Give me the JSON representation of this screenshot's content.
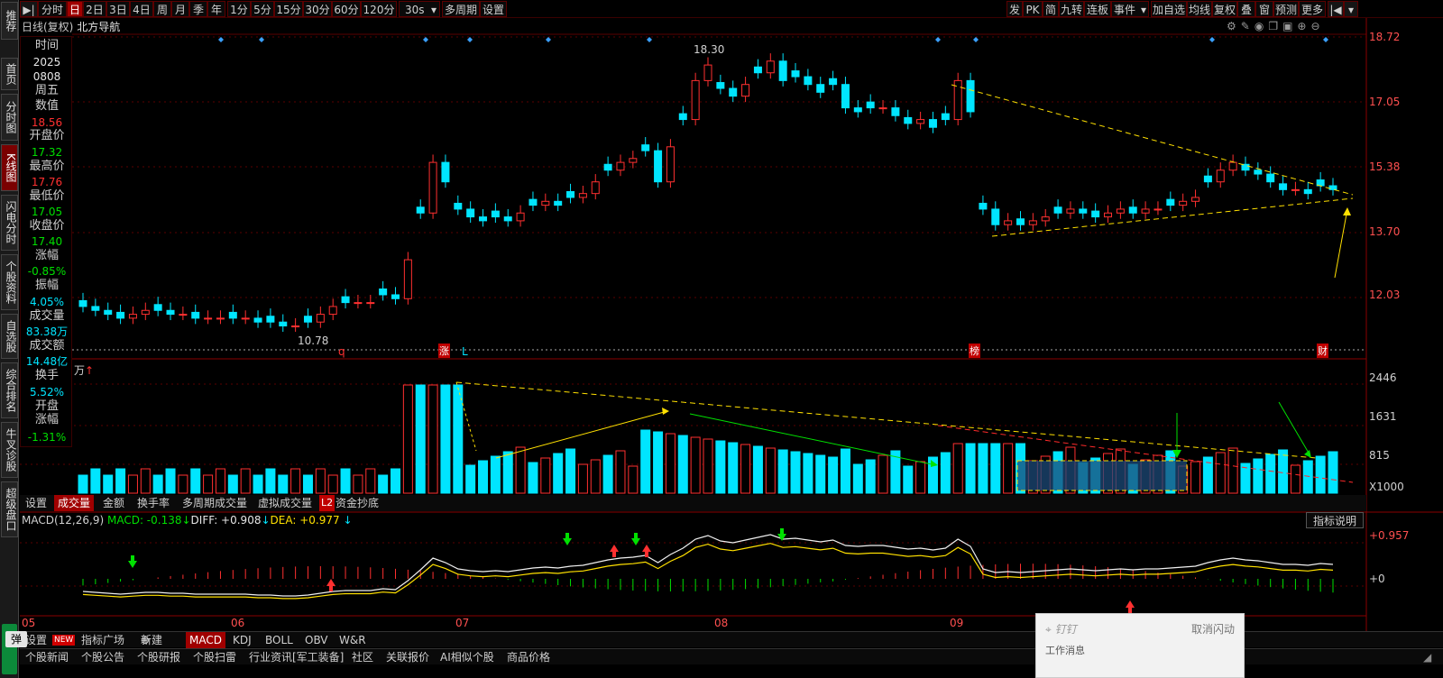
{
  "sidebar": {
    "items": [
      {
        "label": "推荐"
      },
      {
        "label": "首页"
      },
      {
        "label": "分时图"
      },
      {
        "label": "K线图"
      },
      {
        "label": "闪电分时"
      },
      {
        "label": "个股资料"
      },
      {
        "label": "自选股"
      },
      {
        "label": "综合排名"
      },
      {
        "label": "牛叉诊股"
      },
      {
        "label": "超级盘口"
      }
    ]
  },
  "toolbar": {
    "left": [
      "分时",
      "日",
      "2日",
      "3日",
      "4日",
      "周",
      "月",
      "季",
      "年",
      "1分",
      "5分",
      "15分",
      "30分",
      "60分",
      "120分",
      "30s",
      "多周期",
      "设置"
    ],
    "right": [
      "发",
      "PK",
      "简",
      "九转",
      "连板",
      "事件",
      "加自选",
      "均线",
      "复权",
      "叠",
      "窗",
      "预测",
      "更多"
    ],
    "active": "日"
  },
  "chart": {
    "title": "日线(复权)",
    "stock": "北方导航",
    "yaxis": [
      "18.72",
      "17.05",
      "15.38",
      "13.70",
      "12.03"
    ],
    "high_label": "18.30",
    "low_label": "10.78",
    "markers": [
      {
        "text": "q"
      },
      {
        "text": "涨"
      },
      {
        "text": "L"
      },
      {
        "text": "榜"
      },
      {
        "text": "财"
      }
    ]
  },
  "info": {
    "rows": [
      {
        "label": "时间",
        "value": "2025",
        "value2": "0808",
        "value3": "周五"
      },
      {
        "label": "数值",
        "value": "18.56"
      },
      {
        "label": "开盘价",
        "value": "17.32"
      },
      {
        "label": "最高价",
        "value": "17.76"
      },
      {
        "label": "最低价",
        "value": "17.05"
      },
      {
        "label": "收盘价",
        "value": "17.40"
      },
      {
        "label": "涨幅",
        "value": "-0.85%"
      },
      {
        "label": "振幅",
        "value": "4.05%"
      },
      {
        "label": "成交量",
        "value": "83.38万"
      },
      {
        "label": "成交额",
        "value": "14.48亿"
      },
      {
        "label": "换手",
        "value": "5.52%"
      },
      {
        "label": "开盘涨幅",
        "value": "-1.31%"
      }
    ]
  },
  "volume": {
    "unit": "万",
    "yaxis": [
      "2446",
      "1631",
      "815",
      "X1000"
    ]
  },
  "tabs2": {
    "items": [
      "设置",
      "成交量",
      "金额",
      "换手率",
      "多周期成交量",
      "虚拟成交量",
      "资金抄底"
    ],
    "active": "成交量",
    "l2": "L2"
  },
  "macd": {
    "label": "MACD(12,26,9)",
    "macd": "MACD: -0.138",
    "diff": "DIFF: +0.908",
    "dea": "DEA: +0.977",
    "yaxis": [
      "+0.957",
      "+0"
    ],
    "explain": "指标说明"
  },
  "xaxis": [
    "05",
    "06",
    "07",
    "08",
    "09"
  ],
  "tabs3": {
    "items": [
      "设置",
      "指标广场",
      "新建",
      "MACD",
      "KDJ",
      "BOLL",
      "OBV",
      "W&R"
    ],
    "active": "MACD",
    "new_badge": "NEW"
  },
  "tabs4": {
    "items": [
      "个股新闻",
      "个股公告",
      "个股研报",
      "个股扫雷",
      "行业资讯[军工装备]",
      "社区",
      "关联报价",
      "AI相似个股",
      "商品价格"
    ]
  },
  "popup": {
    "pin": "钉钉",
    "cancel": "取消闪动",
    "title": "工作消息"
  },
  "bottom_left": "弹"
}
